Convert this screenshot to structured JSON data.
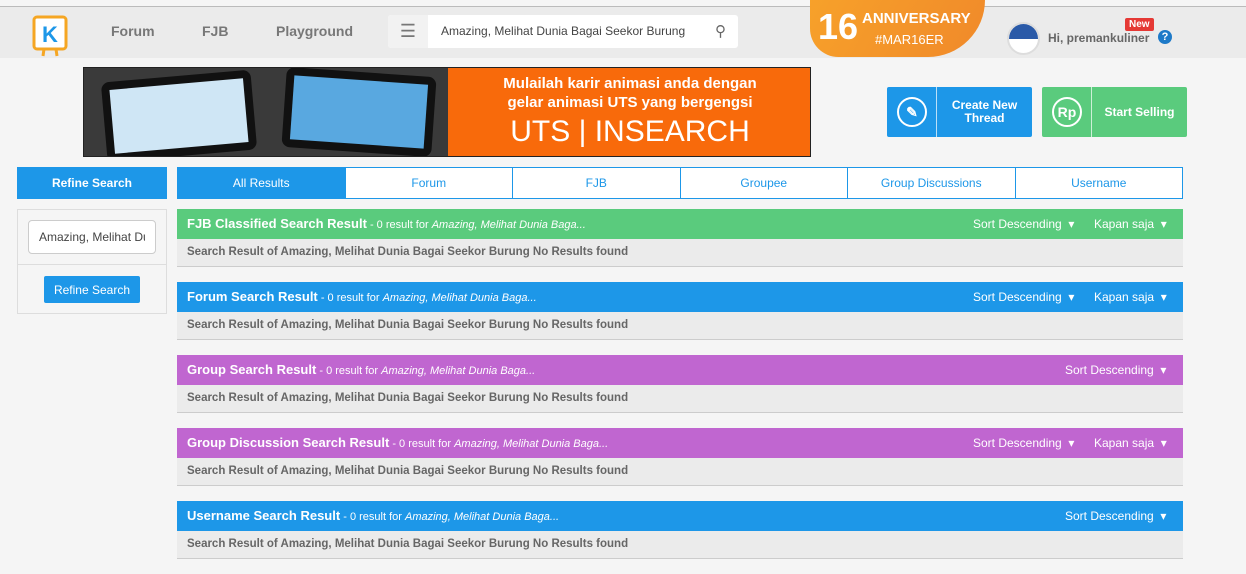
{
  "header": {
    "nav": [
      "Forum",
      "FJB",
      "Playground"
    ],
    "search_value": "Amazing, Melihat Dunia Bagai Seekor Burung",
    "anniversary": {
      "number": "16",
      "title": "ANNIVERSARY",
      "tag": "#MAR16ER"
    },
    "user_greeting": "Hi, premankuliner",
    "new_badge": "New",
    "help": "?"
  },
  "banner": {
    "line1": "Mulailah karir animasi anda dengan",
    "line2": "gelar animasi UTS yang bergengsi",
    "brand": "UTS | INSEARCH"
  },
  "actions": {
    "create": "Create New Thread",
    "sell": "Start Selling",
    "sell_icon": "Rp"
  },
  "sidebar": {
    "title": "Refine Search",
    "input_value": "Amazing, Melihat Dunia Bagai Seekor Burung",
    "button": "Refine Search"
  },
  "tabs": [
    "All Results",
    "Forum",
    "FJB",
    "Groupee",
    "Group Discussions",
    "Username"
  ],
  "sections": [
    {
      "title": "FJB Classified Search Result",
      "count": " - 0 result for ",
      "query": "Amazing, Melihat Dunia Baga...",
      "sort": "Sort Descending",
      "time": "Kapan saja",
      "color": "#5acb7d",
      "body": "Search Result of Amazing, Melihat Dunia Bagai Seekor Burung No Results found"
    },
    {
      "title": "Forum Search Result",
      "count": " - 0 result for ",
      "query": "Amazing, Melihat Dunia Baga...",
      "sort": "Sort Descending",
      "time": "Kapan saja",
      "color": "#1d97e8",
      "body": "Search Result of Amazing, Melihat Dunia Bagai Seekor Burung No Results found"
    },
    {
      "title": "Group Search Result",
      "count": " - 0 result for ",
      "query": "Amazing, Melihat Dunia Baga...",
      "sort": "Sort Descending",
      "time": null,
      "color": "#c066d0",
      "body": "Search Result of Amazing, Melihat Dunia Bagai Seekor Burung No Results found"
    },
    {
      "title": "Group Discussion Search Result",
      "count": " - 0 result for ",
      "query": "Amazing, Melihat Dunia Baga...",
      "sort": "Sort Descending",
      "time": "Kapan saja",
      "color": "#c066d0",
      "body": "Search Result of Amazing, Melihat Dunia Bagai Seekor Burung No Results found"
    },
    {
      "title": "Username Search Result",
      "count": " - 0 result for ",
      "query": "Amazing, Melihat Dunia Baga...",
      "sort": "Sort Descending",
      "time": null,
      "color": "#1d97e8",
      "body": "Search Result of Amazing, Melihat Dunia Bagai Seekor Burung No Results found"
    }
  ],
  "colors": {
    "blue": "#1d97e8",
    "green": "#5acb7d",
    "purple": "#c066d0"
  }
}
